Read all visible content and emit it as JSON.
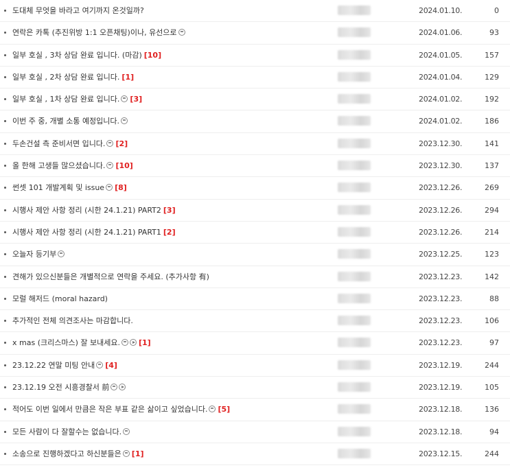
{
  "rows": [
    {
      "title": "도대체 무엇을 바라고 여기까지 온것일까?",
      "icons": [],
      "count": "",
      "date": "2024.01.10.",
      "views": "0"
    },
    {
      "title": "연락은 카톡 (추진위방 1:1 오픈채팅)이나, 유선으로",
      "icons": [
        "smile"
      ],
      "count": "",
      "date": "2024.01.06.",
      "views": "93"
    },
    {
      "title": "일부 호실 , 3차 상담 완료 입니다. (마감)",
      "icons": [],
      "count": "[10]",
      "date": "2024.01.05.",
      "views": "157"
    },
    {
      "title": "일부 호실 , 2차 상담 완료 입니다.",
      "icons": [],
      "count": "[1]",
      "date": "2024.01.04.",
      "views": "129"
    },
    {
      "title": "일부 호실 , 1차 상담 완료 입니다.",
      "icons": [
        "smile"
      ],
      "count": "[3]",
      "date": "2024.01.02.",
      "views": "192"
    },
    {
      "title": "이번 주 중, 개별 소통 예정입니다.",
      "icons": [
        "smile"
      ],
      "count": "",
      "date": "2024.01.02.",
      "views": "186"
    },
    {
      "title": "두손건설 측 준비서면 입니다.",
      "icons": [
        "smile"
      ],
      "count": "[2]",
      "date": "2023.12.30.",
      "views": "141"
    },
    {
      "title": "올 한해 고생들 많으셨습니다.",
      "icons": [
        "smile"
      ],
      "count": "[10]",
      "date": "2023.12.30.",
      "views": "137"
    },
    {
      "title": "썬셋 101 개발계획 및 issue",
      "icons": [
        "smile"
      ],
      "count": "[8]",
      "date": "2023.12.26.",
      "views": "269"
    },
    {
      "title": "시행사 제안 사항 정리 (시한 24.1.21) PART2",
      "icons": [],
      "count": "[3]",
      "date": "2023.12.26.",
      "views": "294"
    },
    {
      "title": "시행사 제안 사항 정리 (시한 24.1.21) PART1",
      "icons": [],
      "count": "[2]",
      "date": "2023.12.26.",
      "views": "214"
    },
    {
      "title": "오늘자 등기부",
      "icons": [
        "smile"
      ],
      "count": "",
      "date": "2023.12.25.",
      "views": "123"
    },
    {
      "title": "견해가 있으신분들은 개별적으로 연락을 주세요. (추가사항 有)",
      "icons": [],
      "count": "",
      "date": "2023.12.23.",
      "views": "142"
    },
    {
      "title": "모럴 해저드 (moral hazard)",
      "icons": [],
      "count": "",
      "date": "2023.12.23.",
      "views": "88"
    },
    {
      "title": "추가적인 전체 의견조사는 마감합니다.",
      "icons": [],
      "count": "",
      "date": "2023.12.23.",
      "views": "106"
    },
    {
      "title": "x mas (크리스마스) 잘 보내세요.",
      "icons": [
        "smile",
        "play"
      ],
      "count": "[1]",
      "date": "2023.12.23.",
      "views": "97"
    },
    {
      "title": "23.12.22 연말 미팅 안내",
      "icons": [
        "smile"
      ],
      "count": "[4]",
      "date": "2023.12.19.",
      "views": "244"
    },
    {
      "title": "23.12.19 오전 시흥경찰서 前",
      "icons": [
        "smile",
        "play"
      ],
      "count": "",
      "date": "2023.12.19.",
      "views": "105"
    },
    {
      "title": "적어도 이번 일에서 만큼은 작은 부표 같은 삶이고 싶었습니다.",
      "icons": [
        "smile"
      ],
      "count": "[5]",
      "date": "2023.12.18.",
      "views": "136"
    },
    {
      "title": "모든 사람이 다 잘할수는 없습니다.",
      "icons": [
        "smile"
      ],
      "count": "",
      "date": "2023.12.18.",
      "views": "94"
    },
    {
      "title": "소송으로 진행하겠다고 하신분들은",
      "icons": [
        "smile"
      ],
      "count": "[1]",
      "date": "2023.12.15.",
      "views": "244"
    }
  ]
}
